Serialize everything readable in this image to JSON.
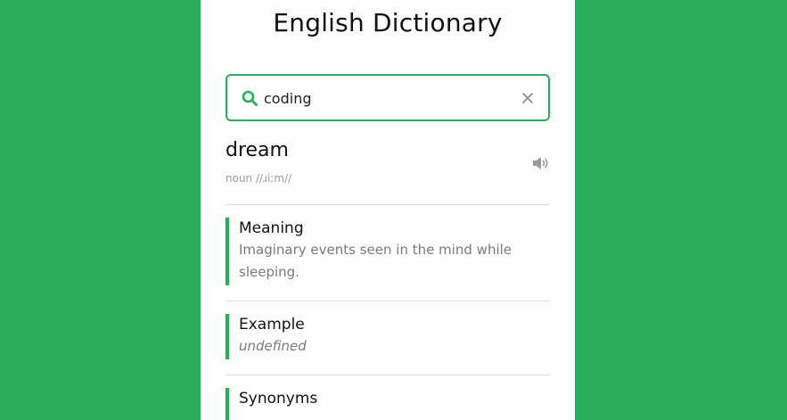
{
  "app": {
    "title": "English Dictionary",
    "accent_color": "#2aae5d"
  },
  "search": {
    "value": "coding",
    "icon": "search-icon",
    "clear_icon": "close-icon"
  },
  "result": {
    "word": "dream",
    "phonetic": "noun //ɹiːm//",
    "speaker_icon": "volume-icon"
  },
  "sections": {
    "meaning": {
      "title": "Meaning",
      "text": "Imaginary events seen in the mind while sleeping."
    },
    "example": {
      "title": "Example",
      "text": "undefined"
    },
    "synonyms": {
      "title": "Synonyms"
    }
  }
}
